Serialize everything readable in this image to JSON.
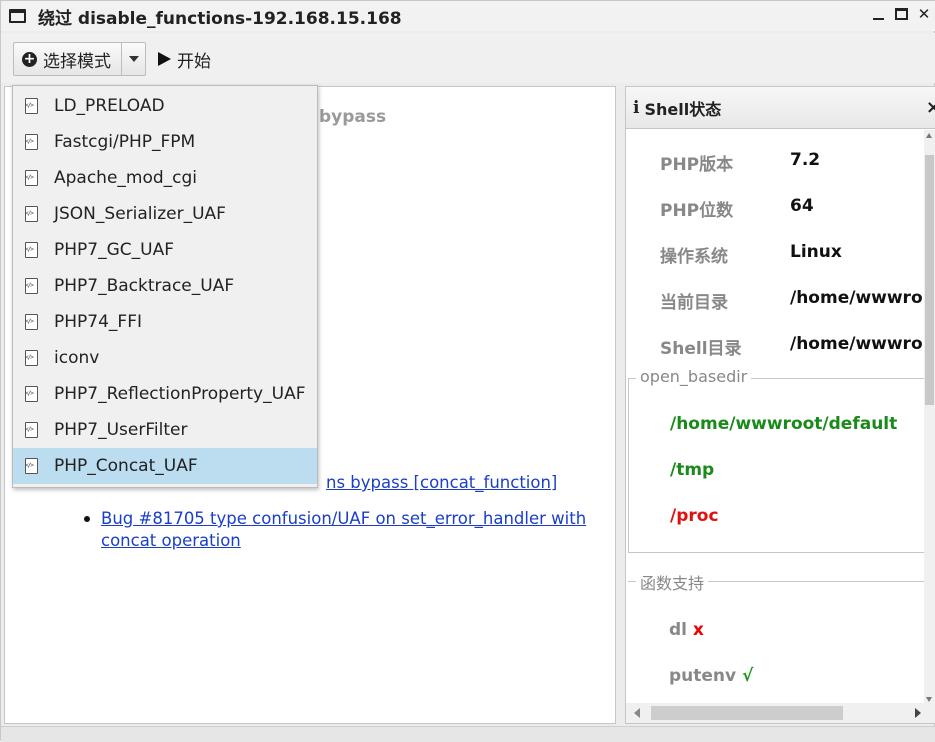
{
  "window": {
    "title": "绕过 disable_functions-192.168.15.168"
  },
  "toolbar": {
    "mode_label": "选择模式",
    "start_label": "开始"
  },
  "content": {
    "heading_fragment": "bypass",
    "links": [
      "... functions bypass [concat_function]",
      "Bug #81705 type confusion/UAF on set_error_handler with concat operation"
    ],
    "link_visible_fragment": "ns bypass [concat_function]"
  },
  "dropdown": {
    "items": [
      {
        "label": "LD_PRELOAD",
        "icon": "code-file-icon",
        "selected": false
      },
      {
        "label": "Fastcgi/PHP_FPM",
        "icon": "code-file-icon",
        "selected": false
      },
      {
        "label": "Apache_mod_cgi",
        "icon": "code-file-icon",
        "selected": false
      },
      {
        "label": "JSON_Serializer_UAF",
        "icon": "code-file-icon",
        "selected": false
      },
      {
        "label": "PHP7_GC_UAF",
        "icon": "code-file-icon",
        "selected": false
      },
      {
        "label": "PHP7_Backtrace_UAF",
        "icon": "code-file-icon",
        "selected": false
      },
      {
        "label": "PHP74_FFI",
        "icon": "code-file-icon",
        "selected": false
      },
      {
        "label": "iconv",
        "icon": "code-file-icon",
        "selected": false
      },
      {
        "label": "PHP7_ReflectionProperty_UAF",
        "icon": "code-file-icon",
        "selected": false
      },
      {
        "label": "PHP7_UserFilter",
        "icon": "code-file-icon",
        "selected": false
      },
      {
        "label": "PHP_Concat_UAF",
        "icon": "code-file-icon",
        "selected": true
      }
    ]
  },
  "shell_panel": {
    "title": "Shell状态",
    "close": "×",
    "info": [
      {
        "label": "PHP版本",
        "value": "7.2"
      },
      {
        "label": "PHP位数",
        "value": "64"
      },
      {
        "label": "操作系统",
        "value": "Linux"
      },
      {
        "label": "当前目录",
        "value": "/home/wwwro"
      },
      {
        "label": "Shell目录",
        "value": "/home/wwwro"
      }
    ],
    "open_basedir_label": "open_basedir",
    "open_basedir": [
      {
        "path": "/home/wwwroot/default",
        "color": "#1a8a1a"
      },
      {
        "path": "/tmp",
        "color": "#1a8a1a"
      },
      {
        "path": "/proc",
        "color": "#e01010"
      }
    ],
    "functions_label": "函数支持",
    "functions": [
      {
        "name": "dl",
        "mark": "x",
        "supported": false
      },
      {
        "name": "putenv",
        "mark": "√",
        "supported": true
      }
    ]
  },
  "colors": {
    "link": "#1a3ec8",
    "selected_bg": "#bcdcf0",
    "ok": "#1a8a1a",
    "bad": "#e01010"
  }
}
